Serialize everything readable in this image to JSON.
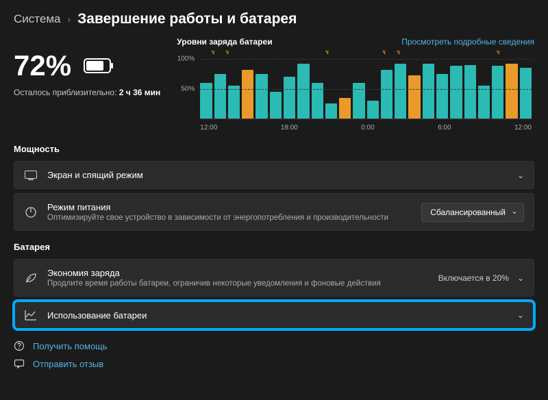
{
  "breadcrumb": {
    "parent": "Система",
    "current": "Завершение работы и батарея"
  },
  "battery": {
    "percent": "72%",
    "remaining_label": "Осталось приблизительно:",
    "remaining_value": "2 ч 36 мин"
  },
  "chart_data": {
    "type": "bar",
    "title": "Уровни заряда батареи",
    "link": "Просмотреть подробные сведения",
    "ylabel": "",
    "xlabel": "",
    "ylim": [
      0,
      100
    ],
    "y_ticks": [
      "100%",
      "50%"
    ],
    "x_ticks": [
      "12:00",
      "18:00",
      "0:00",
      "6:00",
      "12:00"
    ],
    "series": [
      {
        "v": 60,
        "c": "teal"
      },
      {
        "v": 75,
        "c": "teal"
      },
      {
        "v": 55,
        "c": "teal"
      },
      {
        "v": 82,
        "c": "orange"
      },
      {
        "v": 75,
        "c": "teal"
      },
      {
        "v": 45,
        "c": "teal"
      },
      {
        "v": 70,
        "c": "teal"
      },
      {
        "v": 92,
        "c": "teal"
      },
      {
        "v": 60,
        "c": "teal"
      },
      {
        "v": 25,
        "c": "teal"
      },
      {
        "v": 35,
        "c": "orange"
      },
      {
        "v": 60,
        "c": "teal"
      },
      {
        "v": 30,
        "c": "teal"
      },
      {
        "v": 82,
        "c": "teal"
      },
      {
        "v": 92,
        "c": "teal"
      },
      {
        "v": 72,
        "c": "orange"
      },
      {
        "v": 92,
        "c": "teal"
      },
      {
        "v": 75,
        "c": "teal"
      },
      {
        "v": 88,
        "c": "teal"
      },
      {
        "v": 90,
        "c": "teal"
      },
      {
        "v": 55,
        "c": "teal"
      },
      {
        "v": 88,
        "c": "teal"
      },
      {
        "v": 92,
        "c": "orange"
      },
      {
        "v": 85,
        "c": "teal"
      }
    ],
    "arrow_slots": [
      0,
      0,
      1,
      1,
      0,
      0,
      0,
      0,
      0,
      0,
      1,
      0,
      0,
      0,
      1,
      1,
      0,
      0,
      0,
      0,
      0,
      0,
      1,
      0
    ]
  },
  "sections": {
    "power": "Мощность",
    "battery": "Батарея"
  },
  "cards": {
    "screen_sleep": {
      "title": "Экран и спящий режим"
    },
    "power_mode": {
      "title": "Режим питания",
      "sub": "Оптимизируйте свое устройство в зависимости от энергопотребления и производительности",
      "value": "Сбалансированный"
    },
    "battery_saver": {
      "title": "Экономия заряда",
      "sub": "Продлите время работы батареи, ограничив некоторые уведомления и фоновые действия",
      "value": "Включается в 20%"
    },
    "battery_usage": {
      "title": "Использование батареи"
    }
  },
  "footer": {
    "help": "Получить помощь",
    "feedback": "Отправить отзыв"
  }
}
